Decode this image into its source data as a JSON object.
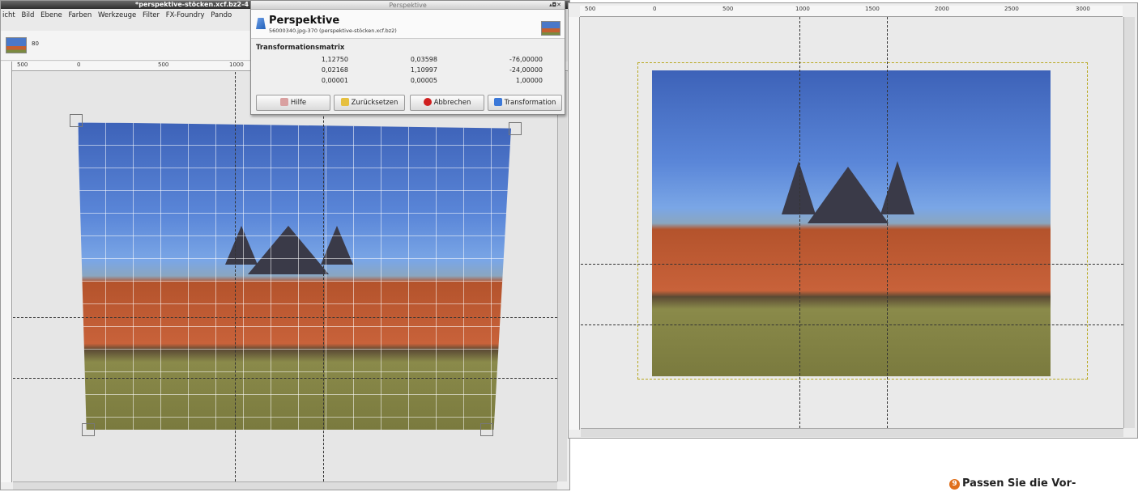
{
  "left_window": {
    "title": "*perspektive-stöcken.xcf.bz2-4",
    "menu": [
      "icht",
      "Bild",
      "Ebene",
      "Farben",
      "Werkzeuge",
      "Filter",
      "FX-Foundry",
      "Pando"
    ],
    "zoom_label": "80",
    "ruler_ticks": [
      "500",
      "0",
      "500",
      "1000"
    ]
  },
  "dialog": {
    "title": "Perspektive",
    "name": "Perspektive",
    "subtitle": "56000340.jpg-370 (perspektive-stöcken.xcf.bz2)",
    "matrix_title": "Transformationsmatrix",
    "matrix": [
      [
        "1,12750",
        "0,03598",
        "-76,00000"
      ],
      [
        "0,02168",
        "1,10997",
        "-24,00000"
      ],
      [
        "0,00001",
        "0,00005",
        "1,00000"
      ]
    ],
    "buttons": {
      "help": "Hilfe",
      "reset": "Zurücksetzen",
      "cancel": "Abbrechen",
      "transform": "Transformation"
    },
    "win_controls": "▴◘✕"
  },
  "right_window": {
    "ruler_ticks": [
      "500",
      "0",
      "500",
      "1000",
      "1500",
      "2000",
      "2500",
      "3000"
    ]
  },
  "caption": {
    "number": "9",
    "text": "Passen Sie die Vor-"
  },
  "colors": {
    "title_bar": "#3a3a3a",
    "accent": "#e0701c"
  }
}
